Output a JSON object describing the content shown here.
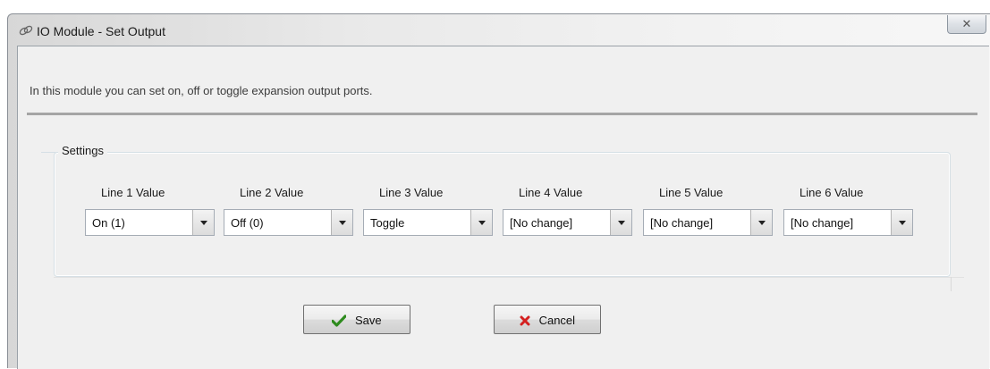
{
  "window": {
    "title": "IO Module - Set Output",
    "close_glyph": "✕",
    "icon": "chain-link-icon"
  },
  "intro_text": "In this module you can set on, off or toggle expansion output ports.",
  "settings": {
    "group_label": "Settings",
    "lines": [
      {
        "label": "Line 1 Value",
        "value": "On (1)"
      },
      {
        "label": "Line 2 Value",
        "value": "Off (0)"
      },
      {
        "label": "Line 3 Value",
        "value": "Toggle"
      },
      {
        "label": "Line 4 Value",
        "value": "[No change]"
      },
      {
        "label": "Line 5 Value",
        "value": "[No change]"
      },
      {
        "label": "Line 6 Value",
        "value": "[No change]"
      }
    ]
  },
  "buttons": {
    "save_label": "Save",
    "save_icon": "checkmark-icon",
    "cancel_label": "Cancel",
    "cancel_icon": "x-mark-icon"
  },
  "colors": {
    "save_icon": "#2e8b1e",
    "cancel_icon": "#d42020"
  }
}
